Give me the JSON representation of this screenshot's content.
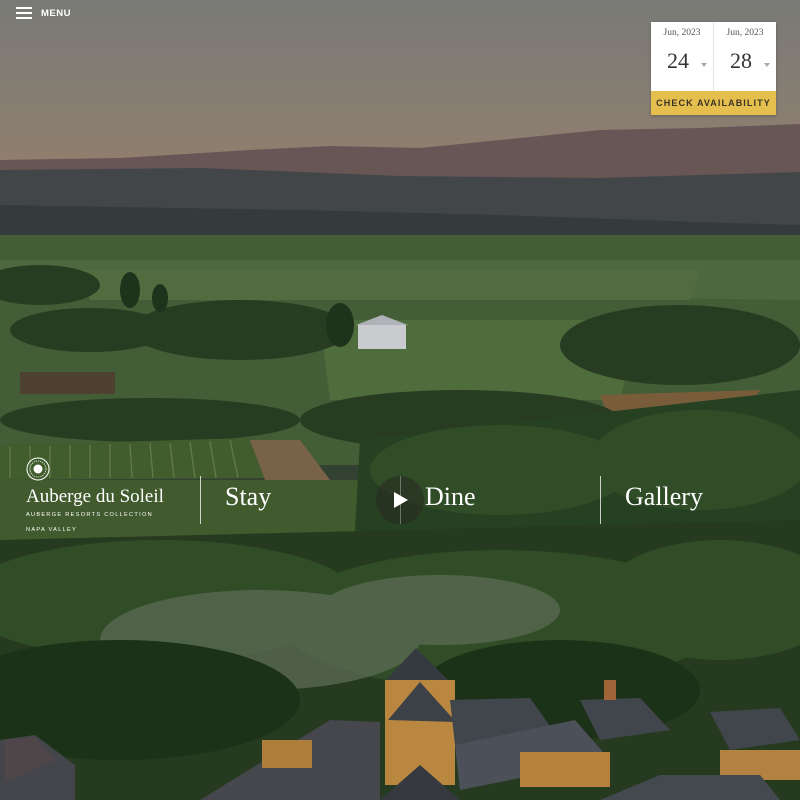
{
  "menu": {
    "label": "MENU",
    "icon": "hamburger-icon"
  },
  "booking": {
    "checkin": {
      "month": "Jun, 2023",
      "day": "24"
    },
    "checkout": {
      "month": "Jun, 2023",
      "day": "28"
    },
    "button_label": "CHECK AVAILABILITY",
    "accent_color": "#e4bf4e"
  },
  "logo": {
    "name": "Auberge du Soleil",
    "collection": "AUBERGE RESORTS COLLECTION",
    "region": "NAPA VALLEY"
  },
  "nav": {
    "stay": "Stay",
    "dine": "Dine",
    "gallery": "Gallery"
  },
  "video": {
    "icon": "play-icon"
  }
}
